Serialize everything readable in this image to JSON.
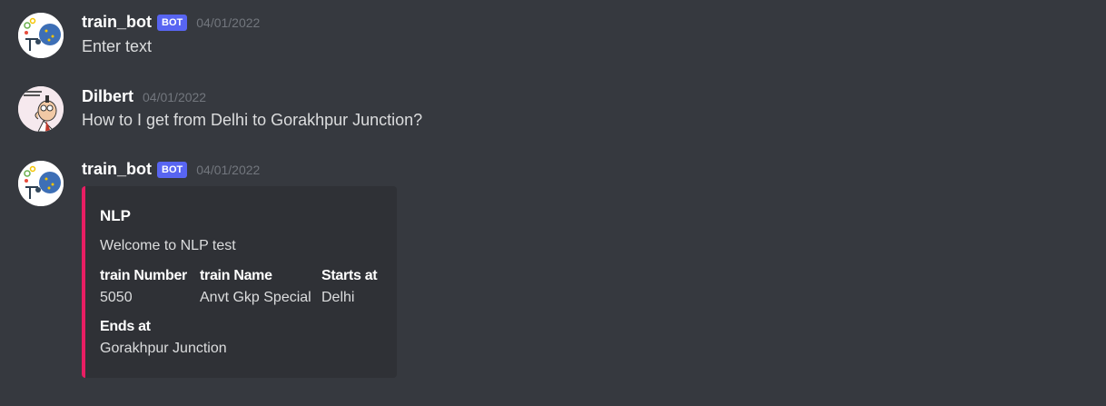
{
  "messages": [
    {
      "username": "train_bot",
      "tag": "BOT",
      "timestamp": "04/01/2022",
      "text": "Enter text"
    },
    {
      "username": "Dilbert",
      "timestamp": "04/01/2022",
      "text": "How to I get from Delhi to Gorakhpur Junction?"
    },
    {
      "username": "train_bot",
      "tag": "BOT",
      "timestamp": "04/01/2022",
      "embed": {
        "accent_color": "#e91e63",
        "title": "NLP",
        "description": "Welcome to NLP test",
        "fields": [
          {
            "name": "train Number",
            "value": "5050"
          },
          {
            "name": "train Name",
            "value": "Anvt Gkp Special"
          },
          {
            "name": "Starts at",
            "value": "Delhi"
          },
          {
            "name": "Ends at",
            "value": "Gorakhpur Junction"
          }
        ]
      }
    }
  ],
  "colors": {
    "background": "#36393f",
    "embed_background": "#2f3136",
    "bot_tag": "#5865f2",
    "timestamp": "#72767d"
  },
  "icons": {
    "train_bot_avatar": "bot-avatar-icon",
    "dilbert_avatar": "dilbert-avatar-icon"
  }
}
